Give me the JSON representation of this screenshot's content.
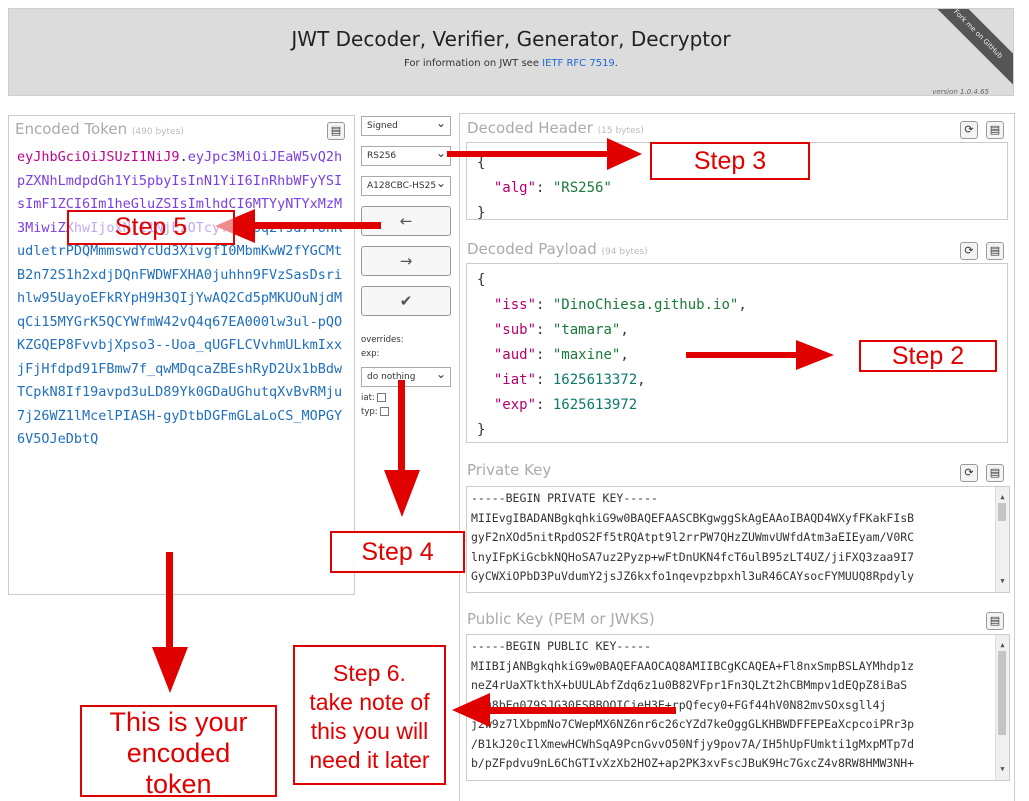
{
  "header": {
    "title": "JWT Decoder, Verifier, Generator, Decryptor",
    "info_prefix": "For information on JWT see ",
    "info_link": "IETF RFC 7519",
    "info_suffix": ".",
    "version": "version 1.0.4.65",
    "ribbon": "Fork me on GitHub"
  },
  "encoded": {
    "title": "Encoded Token",
    "bytes": "(490 bytes)",
    "header_part": "eyJhbGciOiJSUzI1NiJ9",
    "payload_part": "eyJpc3MiOiJEaW5vQ2hpZXNhLmdpdGh1Yi5pbyIsInN1YiI6InRhbWFyYSIsImF1ZCI6Im1heGluZSIsImlhdCI6MTYyNTYxMzM3MiwiZXhwIjoxNjI1NjEzOTcyfQ",
    "signature_part": "Epq2Tsd7fohRudletrPDQMmmswdYcUd3XivgfI0MbmKwW2fYGCMtB2n72S1h2xdjDQnFWDWFXHA0juhhn9FVzSasDsrihlw95UayoEFkRYpH9H3QIjYwAQ2Cd5pMKUOuNjdMqCi15MYGrK5QCYWfmW42vQ4q67EA000lw3ul-pQOKZGQEP8FvvbjXpso3--Uoa_qUGFLCVvhmULkmIxxjFjHfdpd91FBmw7f_qwMDqcaZBEshRyD2Ux1bBdwTCpkN8If19avpd3uLD89Yk0GDaUGhutqXvBvRMju7j26WZ1lMcelPIASH-gyDtbDGFmGLaLoCS_MOPGY6V5OJeDbtQ"
  },
  "middle": {
    "mode_select": "Signed",
    "alg_select": "RS256",
    "enc_select": "A128CBC-HS25",
    "btn_left": "←",
    "btn_right": "→",
    "btn_check": "✔",
    "overrides_label": "overrides:",
    "exp_label": "exp:",
    "exp_select": "do nothing",
    "iat_label": "iat:",
    "typ_label": "typ:"
  },
  "decoded_header": {
    "title": "Decoded Header",
    "bytes": "(15 bytes)",
    "open": "{",
    "close": "}",
    "lines": [
      {
        "key": "\"alg\"",
        "value": "\"RS256\"",
        "type": "string",
        "comma": ""
      }
    ]
  },
  "decoded_payload": {
    "title": "Decoded Payload",
    "bytes": "(94 bytes)",
    "open": "{",
    "close": "}",
    "lines": [
      {
        "key": "\"iss\"",
        "value": "\"DinoChiesa.github.io\"",
        "type": "string",
        "comma": ","
      },
      {
        "key": "\"sub\"",
        "value": "\"tamara\"",
        "type": "string",
        "comma": ","
      },
      {
        "key": "\"aud\"",
        "value": "\"maxine\"",
        "type": "string",
        "comma": ","
      },
      {
        "key": "\"iat\"",
        "value": "1625613372",
        "type": "number",
        "comma": ","
      },
      {
        "key": "\"exp\"",
        "value": "1625613972",
        "type": "number",
        "comma": ""
      }
    ]
  },
  "private_key": {
    "title": "Private Key",
    "lines": [
      "-----BEGIN PRIVATE KEY-----",
      "MIIEvgIBADANBgkqhkiG9w0BAQEFAASCBKgwggSkAgEAAoIBAQD4WXyfFKakFIsB",
      "gyF2nXOd5nitRpdOS2Ff5tRQAtpt9l2rrPW7QHzZUWmvUWfdAtm3aEIEyam/V0RC",
      "lnyIFpKiGcbkNQHoSA7uz2Pyzp+wFtDnUKN4fcT6ulB95zLT4UZ/jiFXQ3zaa9I7",
      "GyCWXiOPbD3PuVdumY2jsJZ6kxfo1nqevpzbpxhl3uR46CAYsocFYMUUQ8Rpdyly"
    ]
  },
  "public_key": {
    "title": "Public Key (PEM or JWKS)",
    "lines": [
      "-----BEGIN PUBLIC KEY-----",
      "MIIBIjANBgkqhkiG9w0BAQEFAAOCAQ8AMIIBCgKCAQEA+Fl8nxSmpBSLAYMhdp1z",
      "neZ4rUaXTkthX+bUULAbfZdq6z1u0B82VFpr1Fn3QLZt2hCBMmpv1dEQpZ8iBaS",
      "5Bu8bEg079SJG30FSBBQOICjeH3E+rpQfecy0+FGf44hV0N82mvSOxsgll4j",
      "j2w9z7lXbpmNo7CWepMX6NZ6nr6c26cYZd7keOggGLKHBWDFFEPEaXcpcoiPRr3p",
      "/B1kJ20cIlXmewHCWhSqA9PcnGvvO50Nfjy9pov7A/IH5hUpFUmkti1gMxpMTp7d",
      "b/pZFpdvu9nL6ChGTIvXzXb2HOZ+ap2PK3xvFscJBuK9Hc7GxcZ4v8RW8HMW3NH+"
    ]
  },
  "annotations": {
    "step2": "Step 2",
    "step3": "Step 3",
    "step4": "Step 4",
    "step5": "Step 5",
    "step6": "Step 6.\ntake note of\nthis you will\nneed it later",
    "encoded_note": "This is your\nencoded\ntoken"
  },
  "colors": {
    "annotation": "#e00000",
    "token_header": "#c2008c",
    "token_payload": "#7b3fe4",
    "token_signature": "#1f6fbf"
  }
}
